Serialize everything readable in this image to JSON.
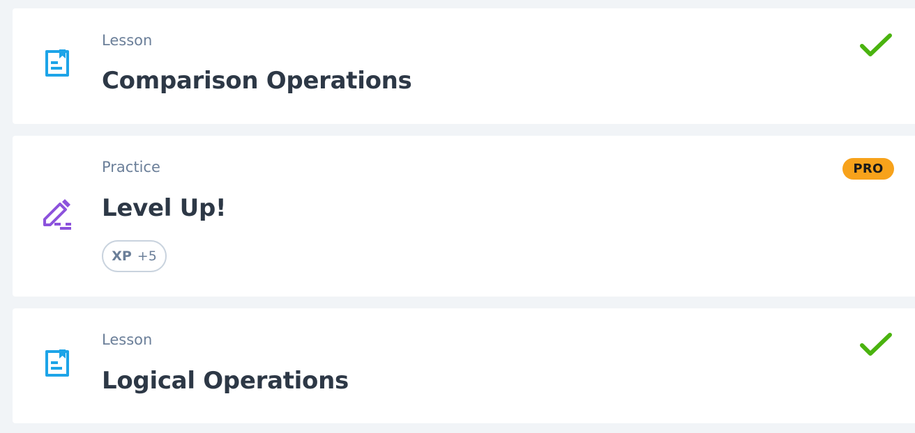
{
  "items": [
    {
      "type_label": "Lesson",
      "title": "Comparison Operations",
      "icon": "lesson-doc-icon",
      "status": "completed",
      "icon_color": "#1da4e8",
      "status_color": "#4ab30f"
    },
    {
      "type_label": "Practice",
      "title": "Level Up!",
      "icon": "pencil-icon",
      "badge": "PRO",
      "xp_label": "XP",
      "xp_value": "+5",
      "icon_color": "#8c52dc",
      "badge_color": "#f7a21b"
    },
    {
      "type_label": "Lesson",
      "title": "Logical Operations",
      "icon": "lesson-doc-icon",
      "status": "completed",
      "icon_color": "#1da4e8",
      "status_color": "#4ab30f"
    }
  ]
}
